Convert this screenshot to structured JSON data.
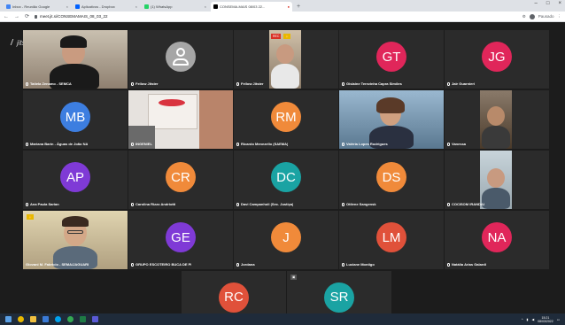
{
  "browser": {
    "tabs": [
      {
        "label": "Inbox - Reunião Google",
        "color": "#4285f4",
        "active": false
      },
      {
        "label": "Aplicativos - Dropbox",
        "color": "#0061ff",
        "active": false
      },
      {
        "label": "(1) WhatsApp",
        "color": "#25d366",
        "active": false
      },
      {
        "label": "CONSEMA-MAIS 08/03 22...",
        "color": "#000000",
        "active": true
      }
    ],
    "url": "meet.jit.si/CONSEMAMAIS_08_03_22",
    "profile_label": "Pausado",
    "window_controls": [
      "–",
      "□",
      "×"
    ]
  },
  "meeting": {
    "brand": "jitsi",
    "participants": [
      {
        "initials": "",
        "name": "Tatiela Zenamo - SEMCA",
        "video": "woman-headset",
        "bg": "#8a7a66"
      },
      {
        "initials": "",
        "name": "Fellow Jitster",
        "video": "default-avatar",
        "bg": "#a6a6a6"
      },
      {
        "initials": "",
        "name": "Fellow Jitster",
        "video": "man-screen",
        "bg": "#9a8a7a"
      },
      {
        "initials": "GT",
        "name": "Gislaine Terezinha Capra Simões",
        "bg": "#e0265a"
      },
      {
        "initials": "JG",
        "name": "Jair Guarnieri",
        "bg": "#e0265a"
      },
      {
        "initials": "MB",
        "name": "Mariana Barin - Águas de João NA",
        "bg": "#3d7ee0"
      },
      {
        "initials": "",
        "name": "INGENIEL",
        "video": "office-poster",
        "bg": "#d8d8d8"
      },
      {
        "initials": "RM",
        "name": "Ricardo Menezello (SAEMA)",
        "bg": "#f08a3a"
      },
      {
        "initials": "",
        "name": "Valéria Lopes Rodrigues",
        "video": "woman-office",
        "bg": "#7aa0c0",
        "speaking": true
      },
      {
        "initials": "",
        "name": "Vanessa",
        "video": "man-room",
        "bg": "#6a5a4a"
      },
      {
        "initials": "AP",
        "name": "Ana Paula Sarian",
        "bg": "#7f3ad6"
      },
      {
        "initials": "CR",
        "name": "Carolina Rizzo Andriotti",
        "bg": "#f08a3a"
      },
      {
        "initials": "DC",
        "name": "Davi Campanholi (Sec. Justiça)",
        "bg": "#1aa3a3"
      },
      {
        "initials": "DS",
        "name": "Otilene Sangensk",
        "bg": "#f08a3a"
      },
      {
        "initials": "",
        "name": "COCISOM IRANDAI",
        "video": "man-wall",
        "bg": "#b8c8d0"
      },
      {
        "initials": "",
        "name": "Giovani M. Fabricio - SEMA/JAGUARI",
        "video": "man-glasses",
        "bg": "#c8b890",
        "highlight": true
      },
      {
        "initials": "GE",
        "name": "GRUPO ESCOTEIRO BUCA DE PI",
        "bg": "#7f3ad6"
      },
      {
        "initials": "J",
        "name": "Jordana",
        "bg": "#f08a3a"
      },
      {
        "initials": "LM",
        "name": "Luciane Montigo",
        "bg": "#e0513a"
      },
      {
        "initials": "NA",
        "name": "Natália Arias Galardi",
        "bg": "#e0265a"
      },
      {
        "initials": "RC",
        "name": "",
        "bg": "#e0513a"
      },
      {
        "initials": "SR",
        "name": "",
        "bg": "#1aa3a3"
      }
    ]
  },
  "taskbar": {
    "icons": [
      "windows-logo",
      "chrome",
      "file-explorer",
      "mail",
      "skype",
      "chrome-alt",
      "excel",
      "teams"
    ],
    "time": "15:21",
    "date": "08/03/2022"
  }
}
